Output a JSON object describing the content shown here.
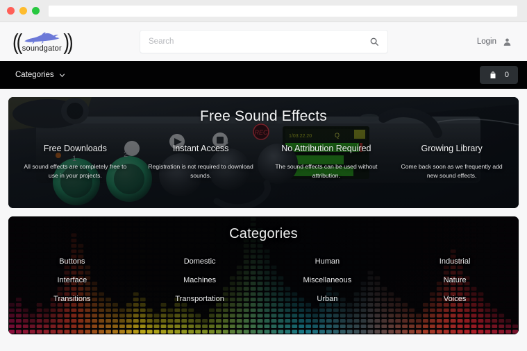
{
  "browser": {
    "traffic_lights": [
      "close",
      "minimize",
      "maximize"
    ],
    "url_value": "",
    "url_placeholder": ""
  },
  "header": {
    "logo": {
      "brand_text": "soundgator",
      "icon": "alligator-logo-icon",
      "left_paren": "((",
      "right_paren": "))",
      "brand_color": "#6c79d8"
    },
    "search": {
      "placeholder": "Search",
      "value": "",
      "icon": "search-icon"
    },
    "account": {
      "label": "Login",
      "icon": "user-icon"
    }
  },
  "nav": {
    "categories_label": "Categories",
    "categories_icon": "chevron-down-icon",
    "cart": {
      "icon": "shopping-bag-icon",
      "count": "0"
    }
  },
  "hero": {
    "title": "Free Sound Effects",
    "features": [
      {
        "title": "Free Downloads",
        "desc": "All sound effects are completely free to use in your projects."
      },
      {
        "title": "Instant Access",
        "desc": "Registration is not required to download sounds."
      },
      {
        "title": "No Attribution Required",
        "desc": "The sound effects can be used without attribution."
      },
      {
        "title": "Growing Library",
        "desc": "Come back soon as we frequently add new sound effects."
      }
    ]
  },
  "categories": {
    "title": "Categories",
    "items": [
      "Buttons",
      "Domestic",
      "Human",
      "Industrial",
      "Interface",
      "Machines",
      "Miscellaneous",
      "Nature",
      "Transitions",
      "Transportation",
      "Urban",
      "Voices"
    ]
  },
  "colors": {
    "nav_bg": "#020203",
    "cart_bg": "#2b2f33",
    "page_bg": "#f7f7f8",
    "header_bg": "#f8f8f9",
    "logo_blue": "#6c79d8",
    "eq_yellow": "#d9c219",
    "eq_teal": "#1b93a6",
    "eq_red": "#c8202c",
    "eq_magenta": "#a31046"
  }
}
